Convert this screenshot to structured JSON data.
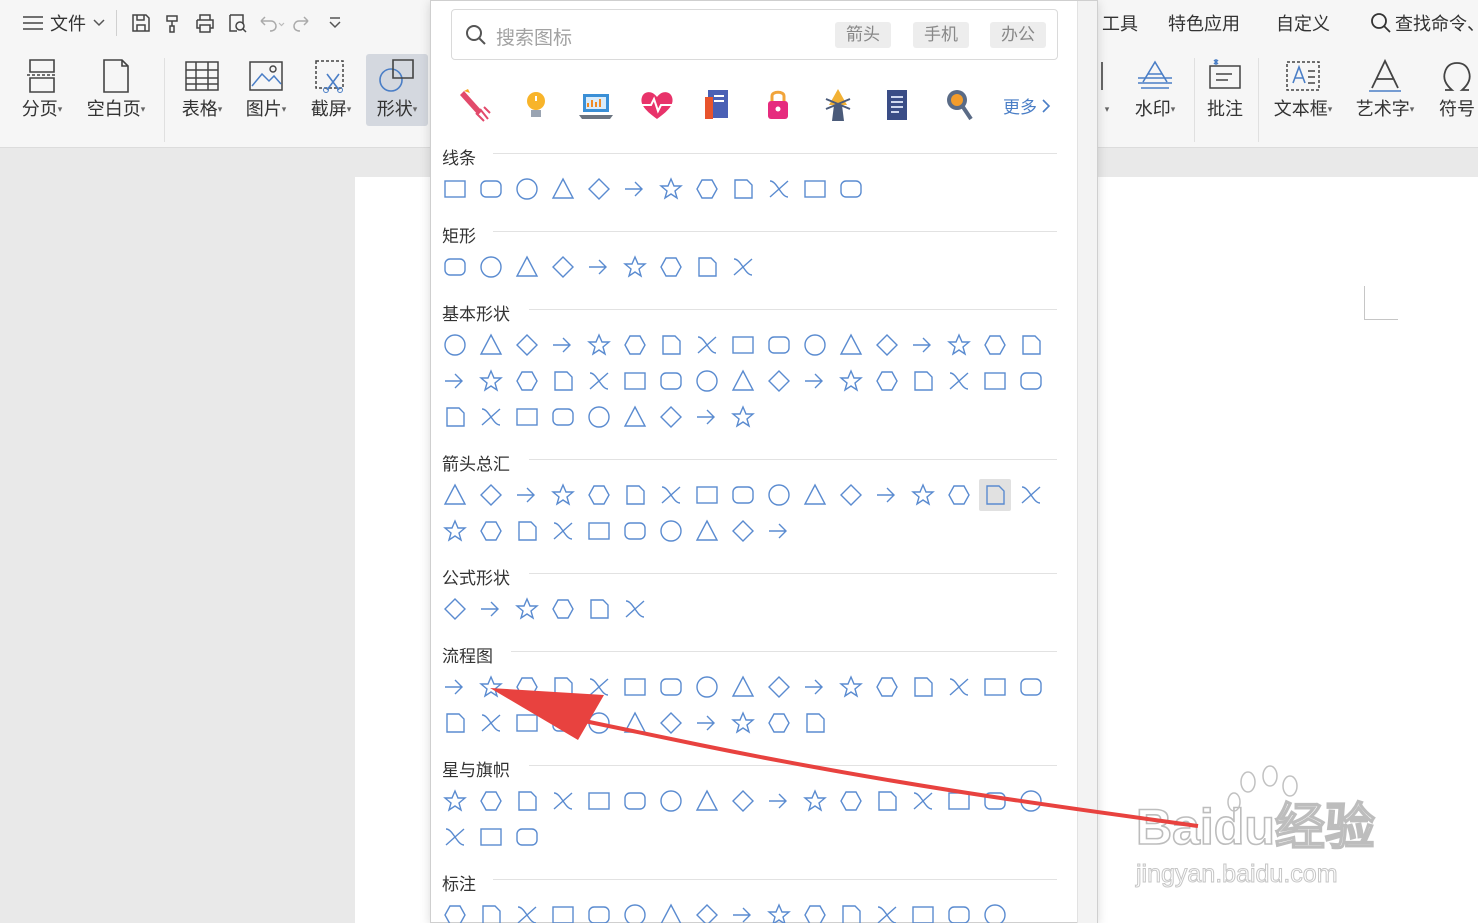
{
  "app": {
    "file_menu": "文件",
    "menu_tabs": [
      "工具",
      "特色应用",
      "自定义"
    ],
    "search_command": "查找命令、"
  },
  "ribbon": [
    {
      "label": "分页",
      "icon": "page-break-icon"
    },
    {
      "label": "空白页",
      "icon": "blank-page-icon"
    },
    {
      "label": "表格",
      "icon": "table-icon"
    },
    {
      "label": "图片",
      "icon": "picture-icon"
    },
    {
      "label": "截屏",
      "icon": "screenshot-icon"
    },
    {
      "label": "形状",
      "icon": "shape-icon",
      "active": true
    },
    {
      "label": "水印",
      "icon": "watermark-icon"
    },
    {
      "label": "批注",
      "icon": "comment-icon"
    },
    {
      "label": "文本框",
      "icon": "textbox-icon"
    },
    {
      "label": "艺术字",
      "icon": "wordart-icon"
    },
    {
      "label": "符号",
      "icon": "symbol-icon"
    }
  ],
  "popup": {
    "search_placeholder": "搜索图标",
    "search_tags": [
      "箭头",
      "手机",
      "办公"
    ],
    "category_icons": [
      "rocket-icon",
      "lightbulb-icon",
      "laptop-icon",
      "heartbeat-icon",
      "book-icon",
      "lock-icon",
      "tower-icon",
      "document-icon",
      "magnifier-icon"
    ],
    "more_label": "更多",
    "sections": [
      {
        "title": "线条",
        "rows": [
          12
        ]
      },
      {
        "title": "矩形",
        "rows": [
          9
        ]
      },
      {
        "title": "基本形状",
        "rows": [
          17,
          17,
          9
        ]
      },
      {
        "title": "箭头总汇",
        "rows": [
          17,
          10
        ]
      },
      {
        "title": "公式形状",
        "rows": [
          6
        ]
      },
      {
        "title": "流程图",
        "rows": [
          17,
          11
        ]
      },
      {
        "title": "星与旗帜",
        "rows": [
          17,
          3
        ]
      },
      {
        "title": "标注",
        "rows": [
          16
        ]
      }
    ]
  },
  "watermark": {
    "brand": "Baidu经验",
    "url": "jingyan.baidu.com"
  },
  "colors": {
    "accent": "#4a7ec6",
    "shape_stroke": "#5a8bd0",
    "annotation_arrow": "#e8423f"
  }
}
